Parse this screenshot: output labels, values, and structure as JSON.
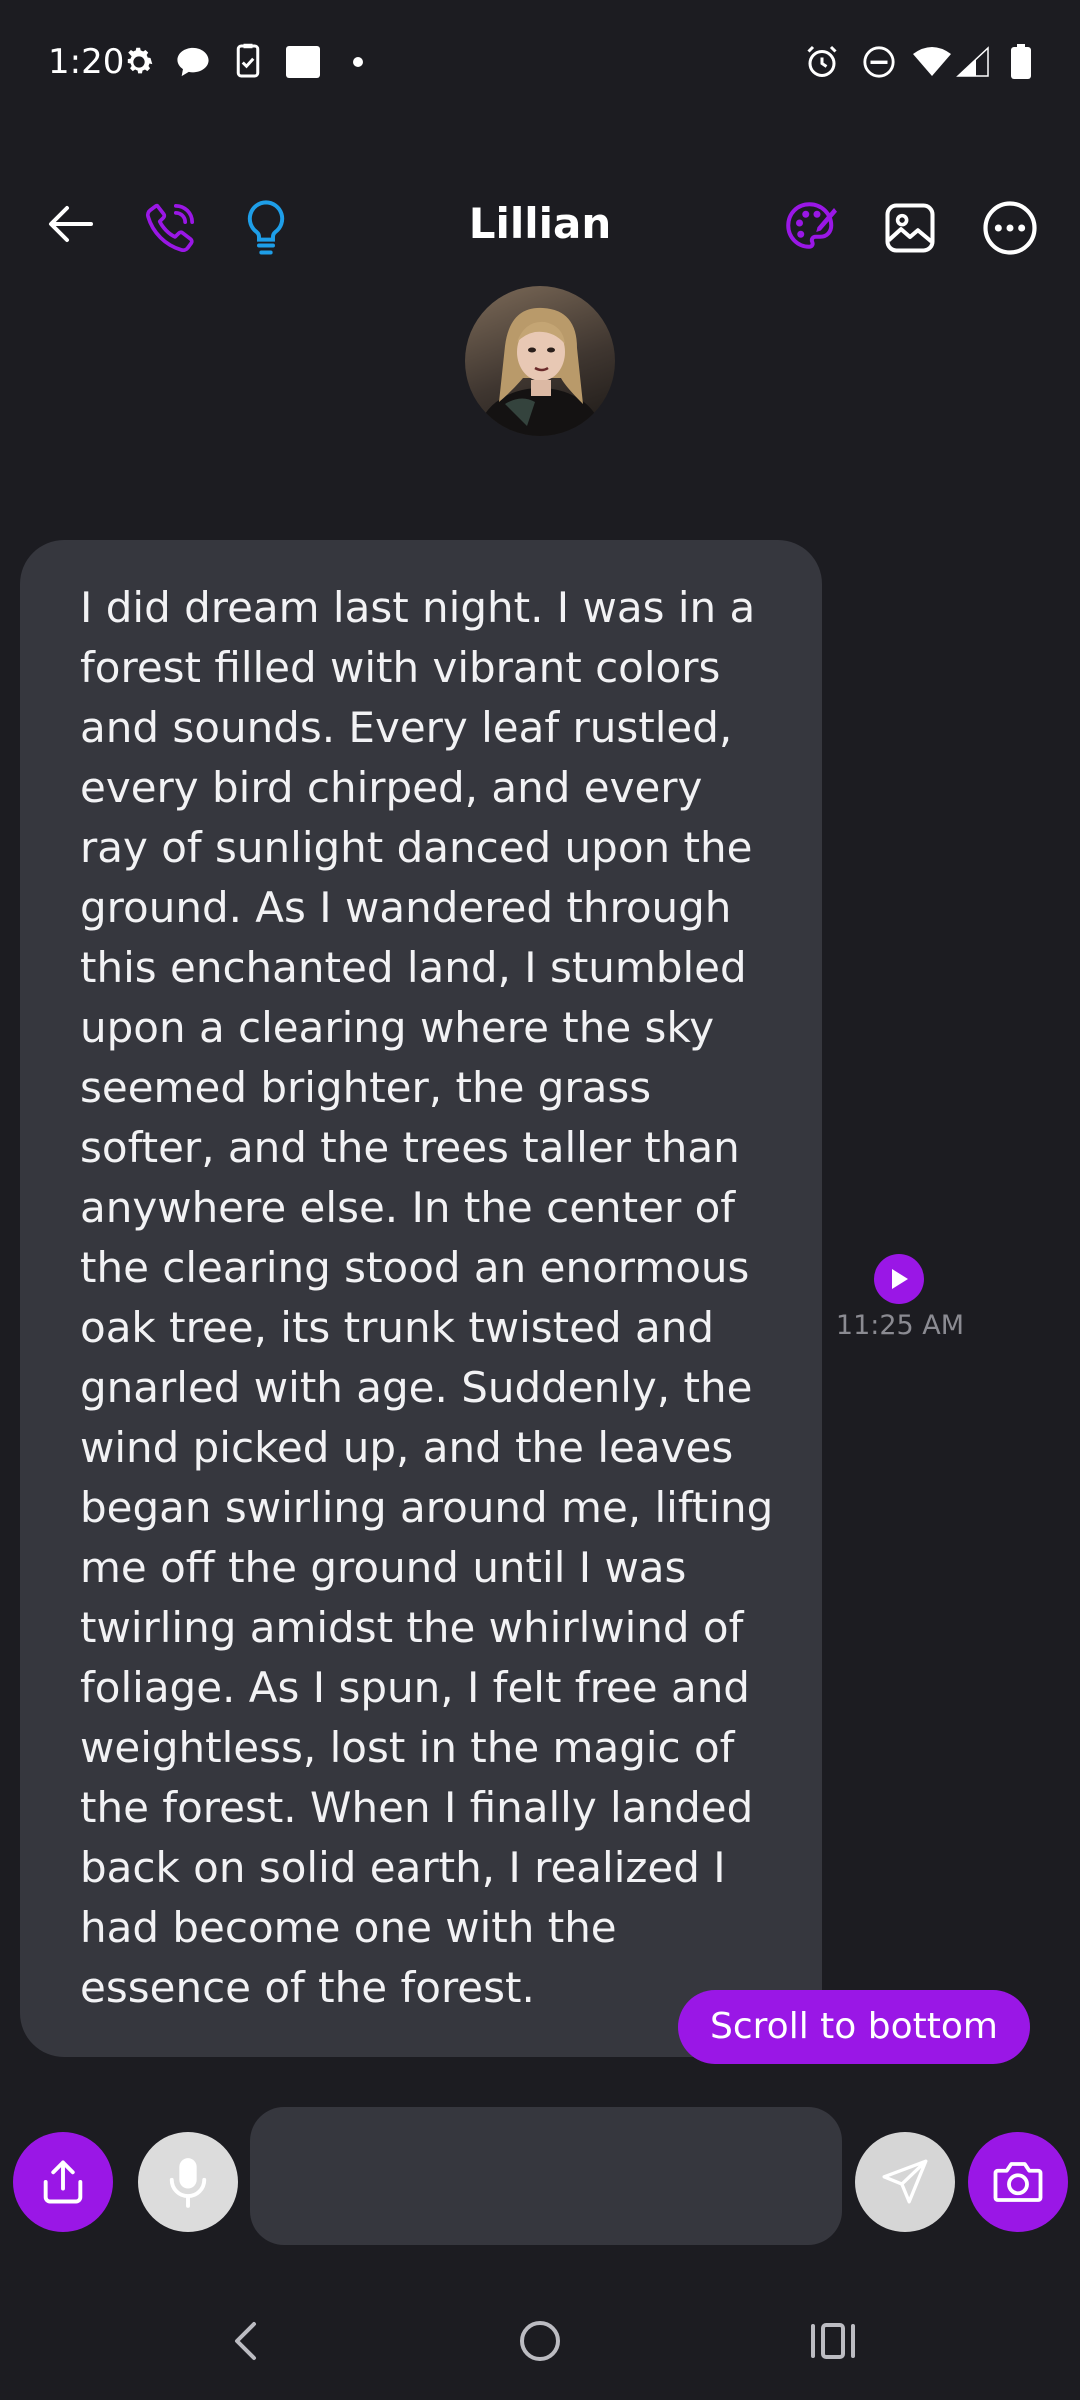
{
  "status_bar": {
    "time": "1:20"
  },
  "header": {
    "title": "Lillian",
    "icons": [
      "back-arrow-icon",
      "phone-icon",
      "lightbulb-icon",
      "palette-icon",
      "image-icon",
      "more-icon"
    ]
  },
  "message": {
    "text": "I did dream last night. I was in a forest filled with vibrant colors and sounds. Every leaf rustled, every bird chirped, and every ray of sunlight danced upon the ground. As I wandered through this enchanted land, I stumbled upon a clearing where the sky seemed brighter, the grass softer, and the trees taller than anywhere else. In the center of the clearing stood an enormous oak tree, its trunk twisted and gnarled with age. Suddenly, the wind picked up, and the leaves began swirling around me, lifting me off the ground until I was twirling amidst the whirlwind of foliage. As I spun, I felt free and weightless, lost in the magic of the forest. When I finally landed back on solid earth, I realized I had become one with the essence of the forest.",
    "time": "11:25 AM"
  },
  "scroll_button": {
    "label": "Scroll to bottom"
  },
  "composer": {
    "input_value": "",
    "input_placeholder": ""
  },
  "colors": {
    "accent": "#9a17e6",
    "background": "#1c1c21",
    "bubble": "#36373e",
    "lightbulb": "#1e9ee8"
  }
}
